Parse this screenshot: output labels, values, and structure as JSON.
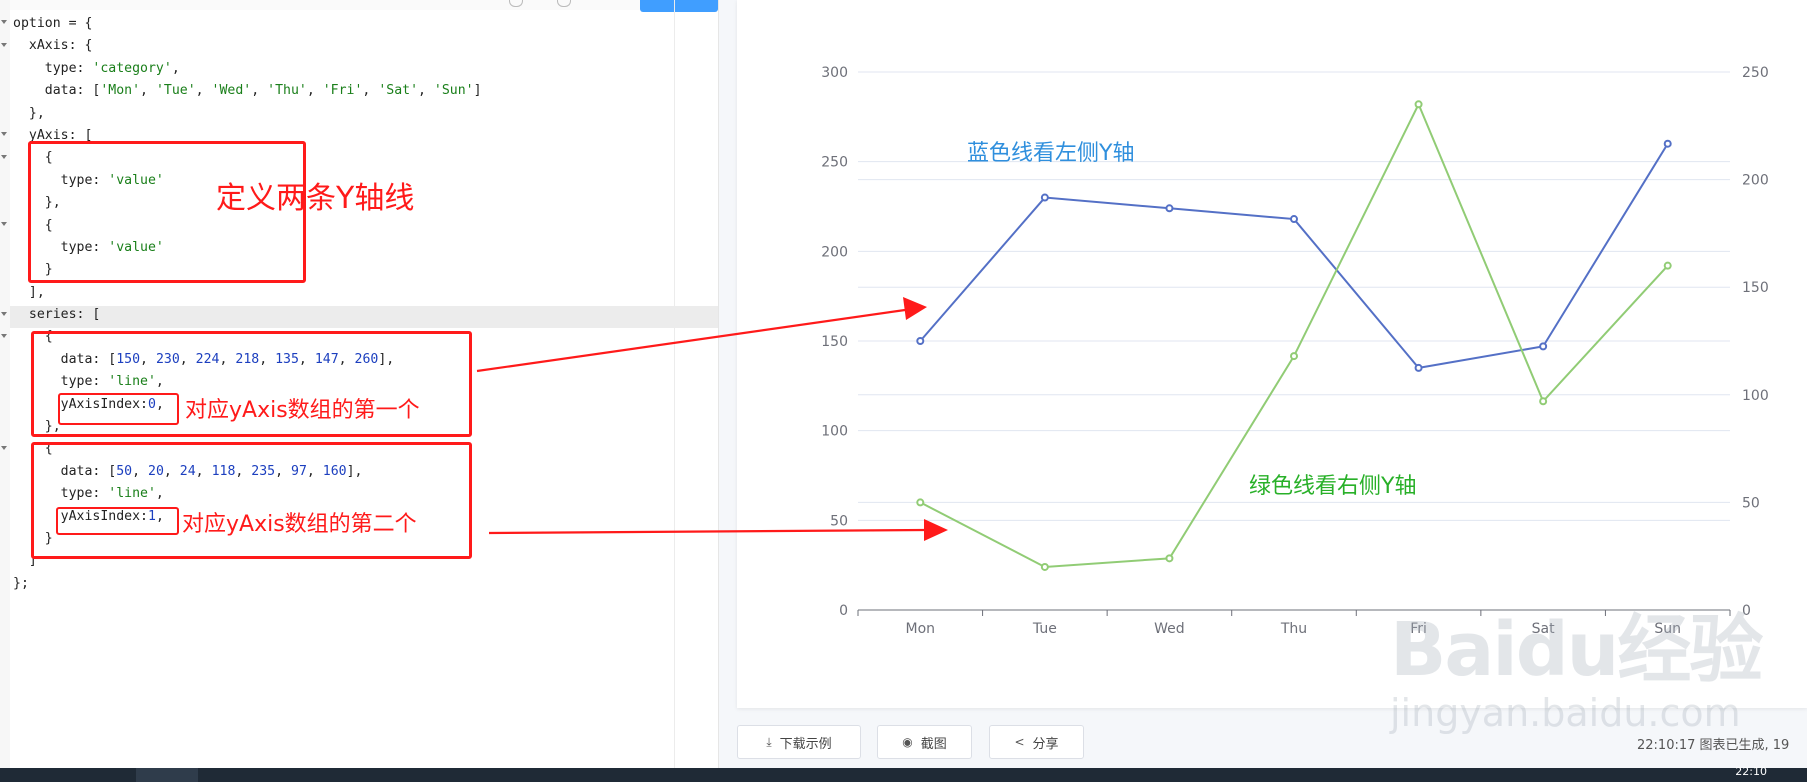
{
  "editor": {
    "run_button_label": "",
    "code_lines": [
      [
        "option = {"
      ],
      [
        "  xAxis: {"
      ],
      [
        "    type: ",
        {
          "s": "'category'"
        },
        ","
      ],
      [
        "    data: [",
        {
          "s": "'Mon'"
        },
        ", ",
        {
          "s": "'Tue'"
        },
        ", ",
        {
          "s": "'Wed'"
        },
        ", ",
        {
          "s": "'Thu'"
        },
        ", ",
        {
          "s": "'Fri'"
        },
        ", ",
        {
          "s": "'Sat'"
        },
        ", ",
        {
          "s": "'Sun'"
        },
        "]"
      ],
      [
        "  },"
      ],
      [
        "  yAxis: ["
      ],
      [
        "    {"
      ],
      [
        "      type: ",
        {
          "s": "'value'"
        }
      ],
      [
        "    },"
      ],
      [
        "    {"
      ],
      [
        "      type: ",
        {
          "s": "'value'"
        }
      ],
      [
        "    }"
      ],
      [
        "  ],"
      ],
      [
        "  series: ["
      ],
      [
        "    {"
      ],
      [
        "      data: [",
        {
          "n": "150"
        },
        ", ",
        {
          "n": "230"
        },
        ", ",
        {
          "n": "224"
        },
        ", ",
        {
          "n": "218"
        },
        ", ",
        {
          "n": "135"
        },
        ", ",
        {
          "n": "147"
        },
        ", ",
        {
          "n": "260"
        },
        "],"
      ],
      [
        "      type: ",
        {
          "s": "'line'"
        },
        ","
      ],
      [
        "      yAxisIndex:",
        {
          "n": "0"
        },
        ","
      ],
      [
        "    },"
      ],
      [
        "    {"
      ],
      [
        "      data: [",
        {
          "n": "50"
        },
        ", ",
        {
          "n": "20"
        },
        ", ",
        {
          "n": "24"
        },
        ", ",
        {
          "n": "118"
        },
        ", ",
        {
          "n": "235"
        },
        ", ",
        {
          "n": "97"
        },
        ", ",
        {
          "n": "160"
        },
        "],"
      ],
      [
        "      type: ",
        {
          "s": "'line'"
        },
        ","
      ],
      [
        "      yAxisIndex:",
        {
          "n": "1"
        },
        ","
      ],
      [
        "    }"
      ],
      [
        "  ]"
      ],
      [
        "};"
      ]
    ]
  },
  "annotations": {
    "define_axes": "定义两条Y轴线",
    "first_axis": "对应yAxis数组的第一个",
    "second_axis": "对应yAxis数组的第二个",
    "blue_line_note": "蓝色线看左侧Y轴",
    "green_line_note": "绿色线看右侧Y轴"
  },
  "chart_data": {
    "type": "line",
    "categories": [
      "Mon",
      "Tue",
      "Wed",
      "Thu",
      "Fri",
      "Sat",
      "Sun"
    ],
    "series": [
      {
        "values": [
          150,
          230,
          224,
          218,
          135,
          147,
          260
        ],
        "color": "#5470c6",
        "yAxisIndex": 0
      },
      {
        "values": [
          50,
          20,
          24,
          118,
          235,
          97,
          160
        ],
        "color": "#91cc75",
        "yAxisIndex": 1
      }
    ],
    "y_left": {
      "min": 0,
      "max": 300,
      "ticks": [
        "0",
        "50",
        "100",
        "150",
        "200",
        "250",
        "300"
      ]
    },
    "y_right": {
      "min": 0,
      "max": 250,
      "ticks": [
        "0",
        "50",
        "100",
        "150",
        "200",
        "250"
      ]
    },
    "grid": true,
    "colors": {
      "blue_note": "#2f8fdd",
      "green_note": "#28b028"
    }
  },
  "toolbar": {
    "download_label": "下载示例",
    "screenshot_label": "截图",
    "share_label": "分享"
  },
  "status": {
    "text": "22:10:17   图表已生成, 19"
  },
  "taskbar": {
    "clock": "22:10"
  },
  "watermark": {
    "line1": "Baidu经验",
    "line2": "jingyan.baidu.com"
  }
}
